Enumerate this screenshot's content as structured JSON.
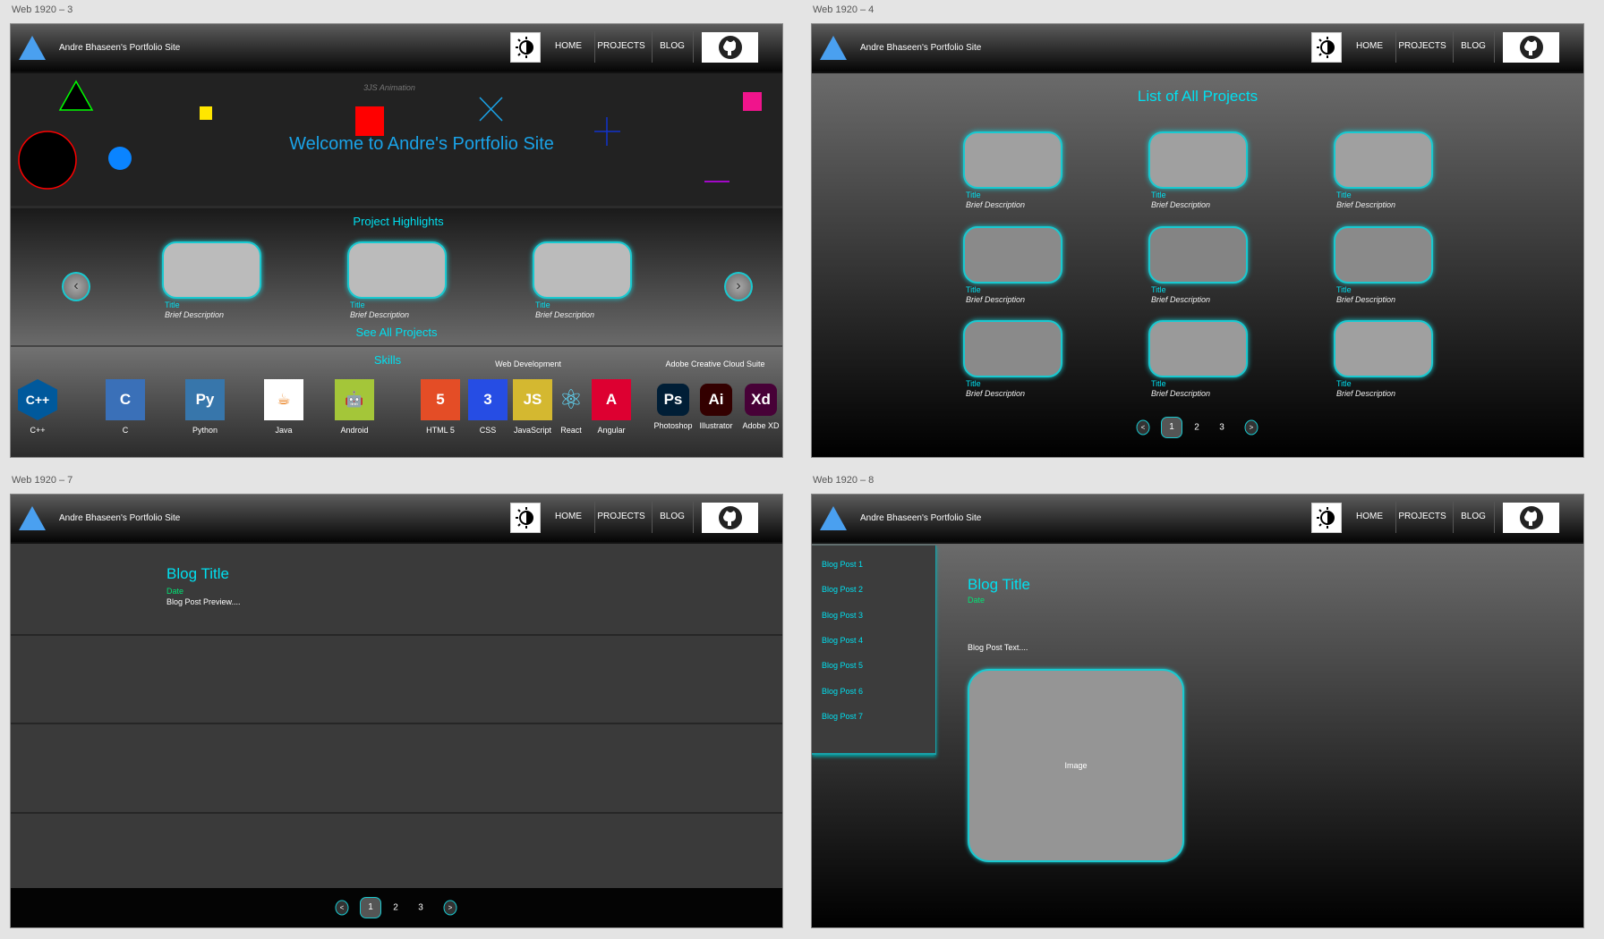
{
  "artboards": [
    "Web 1920 – 3",
    "Web 1920 – 4",
    "Web 1920 – 7",
    "Web 1920 – 8"
  ],
  "header": {
    "site_title": "Andre Bhaseen's Portfolio Site",
    "nav": [
      "HOME",
      "PROJECTS",
      "BLOG"
    ],
    "theme_icon": "sun-half-icon",
    "github_icon": "github-icon"
  },
  "home": {
    "animation_label": "3JS Animation",
    "welcome": "Welcome to Andre's Portfolio Site",
    "highlights_title": "Project Highlights",
    "cards": [
      {
        "title": "Title",
        "desc": "Brief Description"
      },
      {
        "title": "Title",
        "desc": "Brief Description"
      },
      {
        "title": "Title",
        "desc": "Brief Description"
      }
    ],
    "see_all": "See All Projects",
    "skills_title": "Skills",
    "web_dev_label": "Web Development",
    "adobe_label": "Adobe Creative Cloud Suite",
    "skills": [
      {
        "label": "C++",
        "icon": "cpp-icon",
        "color": "#00599c",
        "glyph": "C++"
      },
      {
        "label": "C",
        "icon": "c-icon",
        "color": "#3a70b8",
        "glyph": "C"
      },
      {
        "label": "Python",
        "icon": "python-icon",
        "color": "#3776ab",
        "glyph": "Py"
      },
      {
        "label": "Java",
        "icon": "java-icon",
        "color": "#ffffff",
        "glyph": "☕"
      },
      {
        "label": "Android",
        "icon": "android-icon",
        "color": "#a4c639",
        "glyph": "🤖"
      },
      {
        "label": "HTML 5",
        "icon": "html5-icon",
        "color": "#e44d26",
        "glyph": "5"
      },
      {
        "label": "CSS",
        "icon": "css3-icon",
        "color": "#264de4",
        "glyph": "3"
      },
      {
        "label": "JavaScript",
        "icon": "javascript-icon",
        "color": "#d4b830",
        "glyph": "JS"
      },
      {
        "label": "React",
        "icon": "react-icon",
        "color": "transparent",
        "glyph": "⚛"
      },
      {
        "label": "Angular",
        "icon": "angular-icon",
        "color": "#dd0031",
        "glyph": "A"
      },
      {
        "label": "Photoshop",
        "icon": "photoshop-icon",
        "color": "#001e36",
        "glyph": "Ps"
      },
      {
        "label": "Illustrator",
        "icon": "illustrator-icon",
        "color": "#330000",
        "glyph": "Ai"
      },
      {
        "label": "Adobe XD",
        "icon": "adobe-xd-icon",
        "color": "#470137",
        "glyph": "Xd"
      }
    ]
  },
  "projects": {
    "title": "List of All Projects",
    "cards": [
      {
        "title": "Title",
        "desc": "Brief Description"
      },
      {
        "title": "Title",
        "desc": "Brief Description"
      },
      {
        "title": "Title",
        "desc": "Brief Description"
      },
      {
        "title": "Title",
        "desc": "Brief Description"
      },
      {
        "title": "Title",
        "desc": "Brief Description"
      },
      {
        "title": "Title",
        "desc": "Brief Description"
      },
      {
        "title": "Title",
        "desc": "Brief Description"
      },
      {
        "title": "Title",
        "desc": "Brief Description"
      },
      {
        "title": "Title",
        "desc": "Brief Description"
      }
    ],
    "pagination": {
      "prev": "<",
      "pages": [
        "1",
        "2",
        "3"
      ],
      "current": "1",
      "next": ">"
    }
  },
  "blog_list": {
    "post": {
      "title": "Blog Title",
      "date": "Date",
      "preview": "Blog Post Preview...."
    },
    "pagination": {
      "prev": "<",
      "pages": [
        "1",
        "2",
        "3"
      ],
      "current": "1",
      "next": ">"
    }
  },
  "blog_post": {
    "sidebar": [
      "Blog Post 1",
      "Blog Post 2",
      "Blog Post 3",
      "Blog Post 4",
      "Blog Post 5",
      "Blog Post 6",
      "Blog Post 7"
    ],
    "title": "Blog Title",
    "date": "Date",
    "text": "Blog Post Text....",
    "image_label": "Image"
  },
  "colors": {
    "accent": "#00e0f0",
    "date": "#00e676",
    "welcome": "#1aa3e8"
  }
}
